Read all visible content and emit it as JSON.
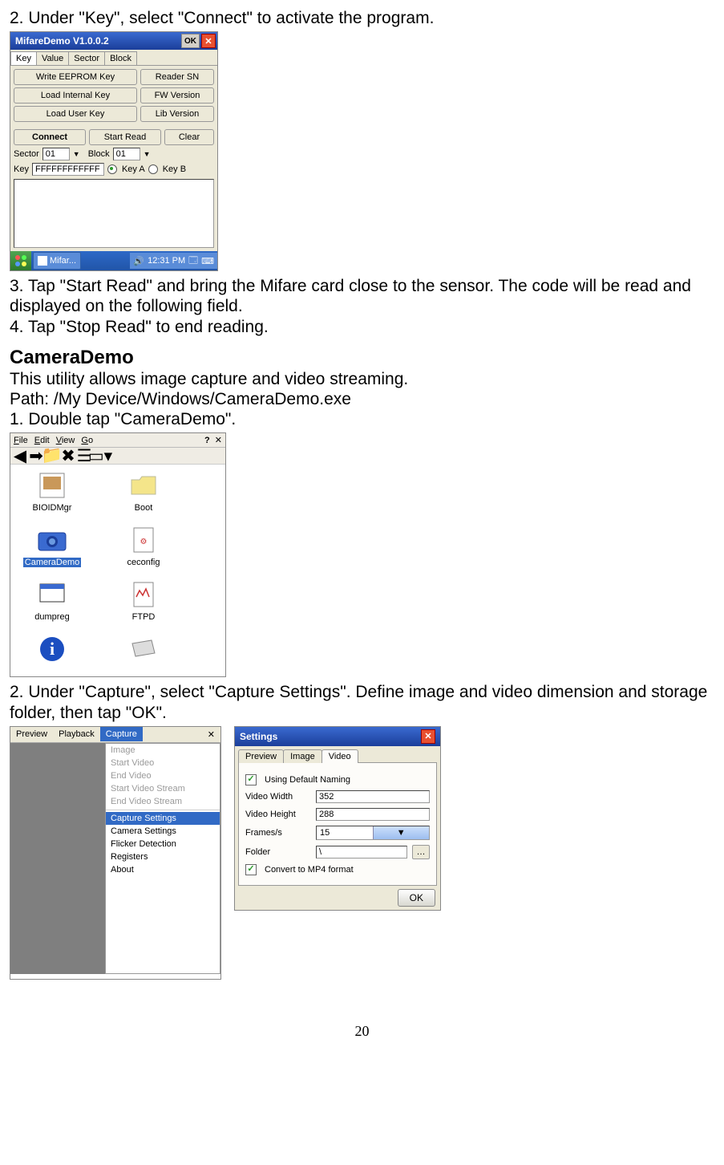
{
  "step2": "2. Under \"Key\", select \"Connect\" to activate the program.",
  "mifare": {
    "title": "MifareDemo V1.0.0.2",
    "ok": "OK",
    "tabs": [
      "Key",
      "Value",
      "Sector",
      "Block"
    ],
    "activeTab": 0,
    "buttons1": [
      "Write EEPROM Key",
      "Reader SN"
    ],
    "buttons2": [
      "Load Internal Key",
      "FW Version"
    ],
    "buttons3": [
      "Load User Key",
      "Lib Version"
    ],
    "buttons4": [
      "Connect",
      "Start Read",
      "Clear"
    ],
    "sectorLbl": "Sector",
    "sectorVal": "01",
    "blockLbl": "Block",
    "blockVal": "01",
    "keyLbl": "Key",
    "keyVal": "FFFFFFFFFFFF",
    "radioA": "Key A",
    "radioB": "Key B",
    "taskbar": {
      "appname": "Mifar...",
      "time": "12:31 PM"
    }
  },
  "step3": "3. Tap \"Start Read\" and bring the Mifare card close to the sensor. The code will be read and displayed on the following field.",
  "step4": "4. Tap \"Stop Read\" to end reading.",
  "cameraDemoHeading": "CameraDemo",
  "cameraDemoDesc": "This utility allows image capture and video streaming.",
  "cameraDemoPath": "Path: /My Device/Windows/CameraDemo.exe",
  "cameraStep1": "1.    Double tap \"CameraDemo\".",
  "explorer": {
    "menus": [
      "File",
      "Edit",
      "View",
      "Go"
    ],
    "files": [
      {
        "name": "BIOIDMgr"
      },
      {
        "name": "Boot"
      },
      {
        "name": "CameraDemo",
        "selected": true
      },
      {
        "name": "ceconfig"
      },
      {
        "name": "dumpreg"
      },
      {
        "name": "FTPD"
      }
    ]
  },
  "cameraStep2": "2. Under \"Capture\", select \"Capture Settings\". Define image and video dimension and storage folder, then tap \"OK\".",
  "cameraWin": {
    "menus": [
      "Preview",
      "Playback",
      "Capture"
    ],
    "activeMenu": 2,
    "items": [
      {
        "label": "Image",
        "disabled": true
      },
      {
        "label": "Start Video",
        "disabled": true
      },
      {
        "label": "End Video",
        "disabled": true
      },
      {
        "label": "Start Video Stream",
        "disabled": true
      },
      {
        "label": "End Video Stream",
        "disabled": true
      },
      {
        "sep": true
      },
      {
        "label": "Capture Settings",
        "selected": true
      },
      {
        "label": "Camera Settings"
      },
      {
        "label": "Flicker Detection"
      },
      {
        "label": "Registers"
      },
      {
        "label": "About"
      }
    ]
  },
  "settings": {
    "title": "Settings",
    "tabs": [
      "Preview",
      "Image",
      "Video"
    ],
    "activeTab": 2,
    "useDefault": "Using Default Naming",
    "videoWidthLbl": "Video Width",
    "videoWidthVal": "352",
    "videoHeightLbl": "Video Height",
    "videoHeightVal": "288",
    "framesLbl": "Frames/s",
    "framesVal": "15",
    "folderLbl": "Folder",
    "folderVal": "\\",
    "convert": "Convert to MP4 format",
    "ok": "OK"
  },
  "pageNumber": "20"
}
